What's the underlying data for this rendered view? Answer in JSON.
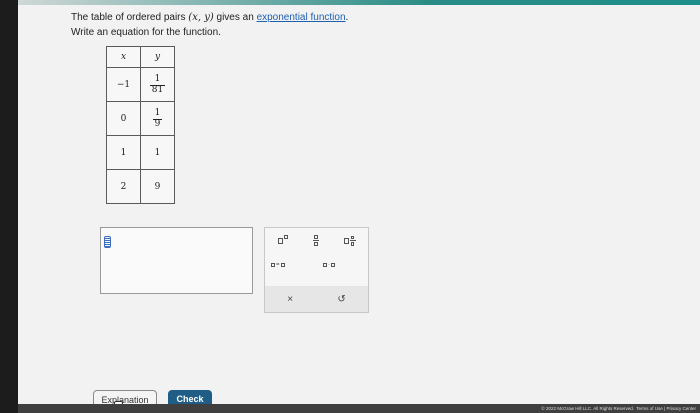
{
  "question": {
    "line1_before": "The table of ordered pairs ",
    "pair": "(x, y)",
    "line1_middle": " gives an ",
    "link": "exponential function",
    "line1_end": ".",
    "line2": "Write an equation for the function."
  },
  "table": {
    "headers": [
      "x",
      "y"
    ],
    "rows": [
      {
        "x": "−1",
        "y_num": "1",
        "y_den": "81"
      },
      {
        "x": "0",
        "y_num": "1",
        "y_den": "9"
      },
      {
        "x": "1",
        "y": "1"
      },
      {
        "x": "2",
        "y": "9"
      }
    ]
  },
  "palette": {
    "clear_symbol": "×",
    "undo_symbol": "↺",
    "equals": "=",
    "dot": "·"
  },
  "buttons": {
    "explanation": "Explanation",
    "check": "Check"
  },
  "footer": {
    "copyright": "© 2022 McGraw Hill LLC. All Rights Reserved.",
    "terms": "Terms of Use",
    "separator": "|",
    "privacy": "Privacy Center"
  },
  "colors": {
    "link": "#1f5fae",
    "check_button": "#1f5d86",
    "cursor": "#3a6dbf"
  }
}
